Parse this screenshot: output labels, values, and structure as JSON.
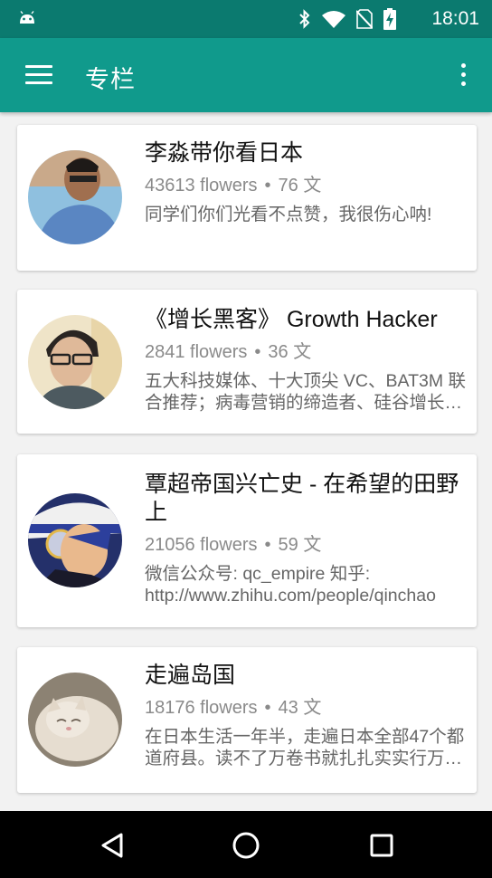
{
  "status_bar": {
    "time": "18:01",
    "icons": [
      "android-icon",
      "bluetooth-icon",
      "wifi-icon",
      "no-sim-icon",
      "battery-charging-icon"
    ]
  },
  "app_bar": {
    "title": "专栏",
    "menu_icon": "hamburger-menu-icon",
    "overflow_icon": "more-vert-icon"
  },
  "columns": [
    {
      "name": "李淼带你看日本",
      "followers": "43613 flowers",
      "separator": "•",
      "posts": "76 文",
      "description": "同学们你们光看不点赞，我很伤心呐!"
    },
    {
      "name": "《增长黑客》 Growth Hacker",
      "followers": "2841 flowers",
      "separator": "•",
      "posts": "36 文",
      "description": "五大科技媒体、十大顶尖 VC、BAT3M 联合推荐；病毒营销的缔造者、硅谷增长黑客"
    },
    {
      "name": "覃超帝国兴亡史 - 在希望的田野上",
      "followers": "21056 flowers",
      "separator": "•",
      "posts": "59 文",
      "description": "微信公众号: qc_empire 知乎: http://www.zhihu.com/people/qinchao"
    },
    {
      "name": "走遍岛国",
      "followers": "18176 flowers",
      "separator": "•",
      "posts": "43 文",
      "description": "在日本生活一年半，走遍日本全部47个都道府县。读不了万卷书就扎扎实实行万里路"
    }
  ],
  "nav_bar": {
    "buttons": [
      "back-icon",
      "home-icon",
      "recents-icon"
    ]
  }
}
